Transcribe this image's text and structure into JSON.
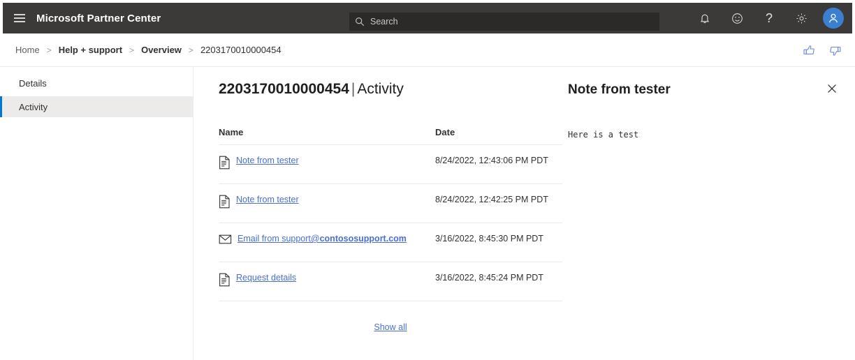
{
  "header": {
    "menu_icon": "hamburger-icon",
    "brand": "Microsoft Partner Center",
    "search": {
      "icon": "search-icon",
      "value": "",
      "placeholder": "Search"
    },
    "icons": [
      {
        "name": "notifications-icon",
        "glyph": "bell"
      },
      {
        "name": "feedback-smiley-icon",
        "glyph": "smiley"
      },
      {
        "name": "help-icon",
        "glyph": "?"
      },
      {
        "name": "settings-gear-icon",
        "glyph": "gear"
      }
    ],
    "avatar": {
      "name": "user-avatar",
      "glyph": "person"
    }
  },
  "breadcrumb": {
    "items": [
      {
        "label": "Home",
        "style": "plain"
      },
      {
        "label": "Help + support",
        "style": "bold"
      },
      {
        "label": "Overview",
        "style": "bold"
      },
      {
        "label": "2203170010000454",
        "style": "last"
      }
    ],
    "separator": ">",
    "thumbs_up": "thumbs-up-icon",
    "thumbs_down": "thumbs-down-icon"
  },
  "sidebar": {
    "items": [
      {
        "label": "Details",
        "selected": false
      },
      {
        "label": "Activity",
        "selected": true
      }
    ]
  },
  "main": {
    "title_id": "2203170010000454",
    "title_separator": "|",
    "title_view": "Activity",
    "table": {
      "columns": {
        "name": "Name",
        "date": "Date"
      },
      "rows": [
        {
          "icon": "document-icon",
          "name": "Note from tester",
          "name_bold_suffix": "",
          "date": "8/24/2022, 12:43:06 PM PDT"
        },
        {
          "icon": "document-icon",
          "name": "Note from tester",
          "name_bold_suffix": "",
          "date": "8/24/2022, 12:42:25 PM PDT"
        },
        {
          "icon": "email-icon",
          "name": "Email from support@",
          "name_bold_suffix": "contososupport.com",
          "date": "3/16/2022, 8:45:30 PM PDT"
        },
        {
          "icon": "document-icon",
          "name": "Request details",
          "name_bold_suffix": "",
          "date": "3/16/2022, 8:45:24 PM PDT"
        }
      ]
    },
    "show_all": "Show all"
  },
  "detail_pane": {
    "title": "Note from tester",
    "body": "Here is a test",
    "close_icon": "close-icon"
  },
  "colors": {
    "header_bg": "#3b3a39",
    "search_bg": "#2b2a29",
    "accent": "#0078d4",
    "link": "#4a6fd4",
    "avatar_bg": "#3c7fd0",
    "selected_bg": "#edebe9",
    "border": "#edebe9"
  }
}
